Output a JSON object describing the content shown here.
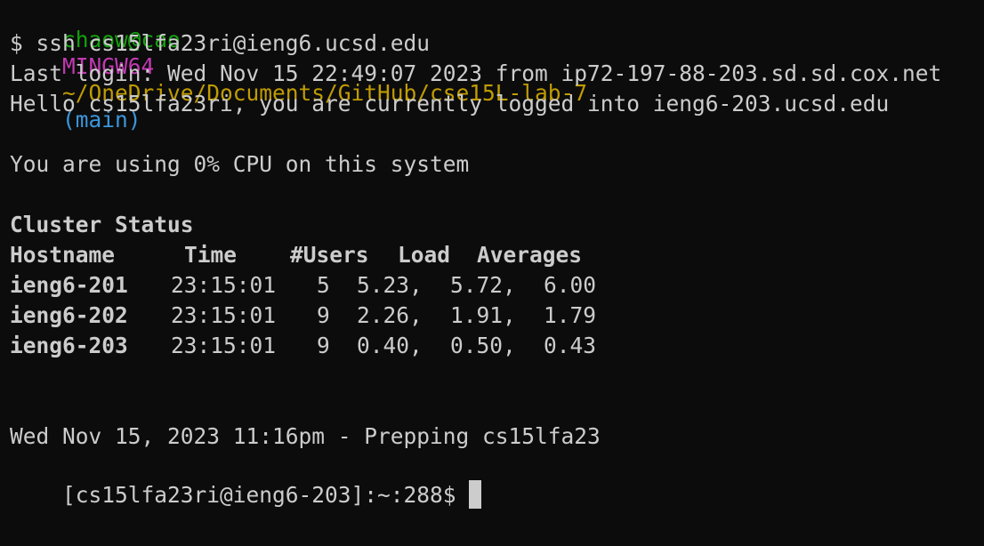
{
  "prompt": {
    "user_host": "chaow@cao",
    "shell": "MINGW64",
    "path": "~/OneDrive/Documents/GitHub/cse15L-lab-7",
    "branch": "(main)"
  },
  "command": "$ ssh cs15lfa23ri@ieng6.ucsd.edu",
  "last_login": "Last login: Wed Nov 15 22:49:07 2023 from ip72-197-88-203.sd.sd.cox.net",
  "hello": "Hello cs15lfa23ri, you are currently logged into ieng6-203.ucsd.edu",
  "cpu": "You are using 0% CPU on this system",
  "cluster": {
    "title": "Cluster Status",
    "headers": {
      "hostname": "Hostname",
      "time": "Time",
      "users": "#Users",
      "load": "Load",
      "averages": "Averages"
    },
    "rows": [
      {
        "host": "ieng6-201",
        "time": "23:15:01",
        "users": "5",
        "l1": "5.23,",
        "l2": "5.72,",
        "l3": "6.00"
      },
      {
        "host": "ieng6-202",
        "time": "23:15:01",
        "users": "9",
        "l1": "2.26,",
        "l2": "1.91,",
        "l3": "1.79"
      },
      {
        "host": "ieng6-203",
        "time": "23:15:01",
        "users": "9",
        "l1": "0.40,",
        "l2": "0.50,",
        "l3": "0.43"
      }
    ]
  },
  "prepping": "Wed Nov 15, 2023 11:16pm - Prepping cs15lfa23",
  "remote_prompt": "[cs15lfa23ri@ieng6-203]:~:288$"
}
